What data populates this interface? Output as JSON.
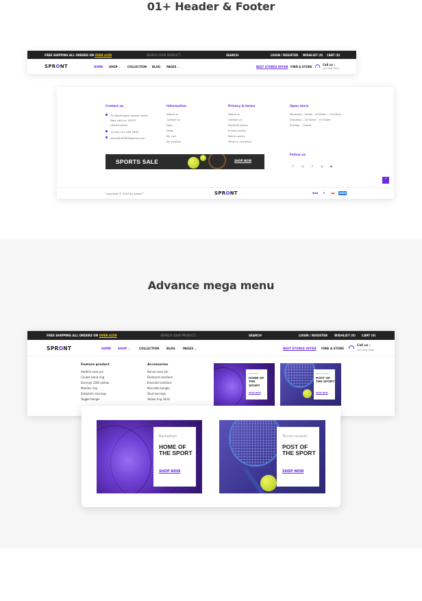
{
  "section1": {
    "title": "01+ Header & Footer"
  },
  "section2": {
    "title": "Advance mega menu"
  },
  "topbar": {
    "shipping_text": "FREE SHIPPING ALL ORDERS ON",
    "shipping_highlight": "OVER $150",
    "search_placeholder": "SEARCH YOUR PRODUCT...",
    "search_button": "SEARCH",
    "login": "LOGIN / REGISTER",
    "wishlist": "WISHLIST (0)",
    "cart": "CART (0)"
  },
  "nav": {
    "logo_prefix": "SPR",
    "logo_o": "O",
    "logo_suffix": "NT",
    "home": "HOME",
    "shop": "SHOP ⌄",
    "collection": "COLLECTION",
    "blog": "BLOG",
    "pages": "PAGES ⌄",
    "best_stores": "BEST STORES OFFER",
    "find_store": "FIND A STORE",
    "call_label": "Call us :",
    "call_number": "123 456 7900"
  },
  "footer": {
    "contact": {
      "heading": "Contact us",
      "address": [
        "70 Washington square south,",
        "New york ny 10012,",
        "United states"
      ],
      "phone": "+(252) 123 456 7890",
      "email": "demo@45583@gmail.com"
    },
    "information": {
      "heading": "Information",
      "items": [
        "About us",
        "Contact us",
        "Faqs",
        "News",
        "My cart",
        "My wishlist"
      ]
    },
    "privacy": {
      "heading": "Privacy & terms",
      "items": [
        "About us",
        "Contact us",
        "Payment policy",
        "Privacy policy",
        "Return policy",
        "Terms & condition"
      ]
    },
    "open_store": {
      "heading": "Open store",
      "items": [
        "Mounday – Friday : 09:00am – 11:00pm",
        "Saturday – 10:00am – 07:00pm",
        "Sunday – Closed"
      ]
    },
    "banner": {
      "title": "SPORTS SALE",
      "button": "SHOP NOW"
    },
    "follow": {
      "heading": "Follow us",
      "icons": [
        "f",
        "◎",
        "t",
        "p",
        "▶"
      ]
    },
    "copyright": "Copyright © 2024 by sodex™",
    "payments": [
      "VISA",
      "P",
      "●●",
      "AMEX"
    ]
  },
  "mega": {
    "feature": {
      "heading": "Feature product",
      "items": [
        "Aadhila nose pin",
        "Couple band ring",
        "Earrings 22Kt yellow",
        "Mamba ring",
        "Simplistic earrings",
        "Toggle bangle"
      ]
    },
    "accessories": {
      "heading": "Accessories",
      "items": [
        "Bonsa nose pin",
        "Diamond necklace",
        "Emerald necklace",
        "Muncelle bangle",
        "Stud earrings",
        "Yellow ring 18 kt"
      ]
    },
    "promo_small": [
      {
        "sub": "Basketball",
        "title_l1": "HOME OF",
        "title_l2": "THE SPORT",
        "button": "SHOP NOW"
      },
      {
        "sub": "Tennis racquet",
        "title_l1": "POST OF",
        "title_l2": "THE SPORT",
        "button": "SHOP NOW"
      }
    ],
    "promo_large": [
      {
        "sub": "Basketball",
        "title_l1": "HOME OF",
        "title_l2": "THE SPORT",
        "button": "SHOP NOW"
      },
      {
        "sub": "Tennis racquet",
        "title_l1": "POST OF",
        "title_l2": "THE SPORT",
        "button": "SHOP NOW"
      }
    ]
  },
  "colors": {
    "accent": "#6a2ce0",
    "topbar_bg": "#222222",
    "highlight": "#ffd400"
  }
}
